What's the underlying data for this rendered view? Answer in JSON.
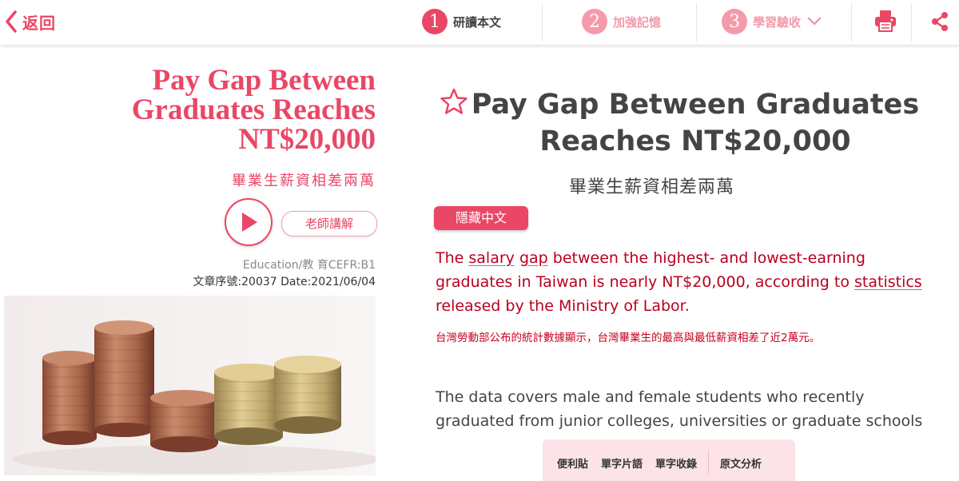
{
  "topbar": {
    "back_label": "返回",
    "steps": [
      {
        "number": "1",
        "label": "研讀本文",
        "state": "active"
      },
      {
        "number": "2",
        "label": "加強記憶",
        "state": "inactive"
      },
      {
        "number": "3",
        "label": "學習驗收",
        "state": "inactive"
      }
    ],
    "icons": [
      "print-icon",
      "share-icon"
    ]
  },
  "left": {
    "title_lines": [
      "Pay Gap Between",
      "Graduates Reaches",
      "NT$20,000"
    ],
    "subtitle": "畢業生薪資相差兩萬",
    "teacher_button": "老師講解",
    "meta_category": "Education/教 育CEFR:B1",
    "meta_serial": "文章序號:20037 Date:2021/06/04"
  },
  "article": {
    "title_lines": [
      "Pay Gap Between Graduates",
      "Reaches NT$20,000"
    ],
    "subtitle": "畢業生薪資相差兩萬",
    "hide_chinese_button": "隱藏中文",
    "para1": {
      "t1": "The ",
      "w1": "salary",
      "t2": " ",
      "w2": "gap",
      "t3": " between the highest- and lowest-earning graduates in Taiwan is nearly NT$20,000, according to ",
      "w3": "statistics",
      "t4": " released by the Ministry of Labor."
    },
    "para1_zh": "台灣勞動部公布的統計數據顯示，台灣畢業生的最高與最低薪資相差了近2萬元。",
    "para2_lines": [
      "The data covers male and female students who recently",
      "graduated from junior colleges, universities or graduate schools"
    ]
  },
  "toolbar": {
    "items": [
      "便利貼",
      "單字片語",
      "單字收錄",
      "原文分析"
    ]
  },
  "colors": {
    "accent": "#e94765",
    "accent_light": "#f49aaa",
    "english_text": "#b9001e",
    "toolbar_bg": "#fbe3e7"
  }
}
